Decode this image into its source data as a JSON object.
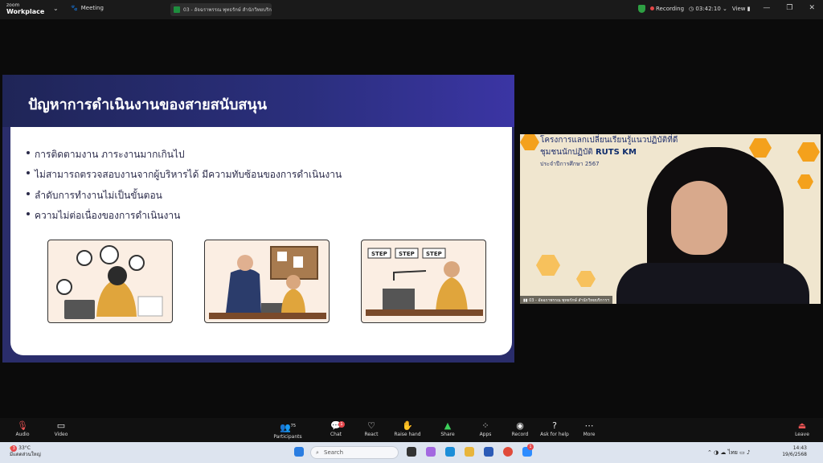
{
  "titlebar": {
    "logo_top": "zoom",
    "logo_bottom": "Workplace",
    "meeting": "Meeting",
    "share_title": "03 - อัจฉราพรรณ พุทธรักษ์ สำนักวิทยบริการ",
    "recording": "Recording",
    "timer": "03:42:10",
    "view": "View"
  },
  "slide": {
    "title": "ปัญหาการดำเนินงานของสายสนับสนุน",
    "bullets": [
      "การติดตามงาน ภาระงานมากเกินไป",
      "ไม่สามารถตรวจสอบงานจากผู้บริหารได้ มีความทับซ้อนของการดำเนินงาน",
      "ลำดับการทำงานไม่เป็นขั้นตอน",
      "ความไม่ต่อเนื่องของการดำเนินงาน"
    ],
    "steps": [
      "STEP",
      "STEP",
      "STEP"
    ]
  },
  "video": {
    "banner_line1": "โครงการแลกเปลี่ยนเรียนรู้แนวปฏิบัติที่ดี",
    "banner_line2": "ชุมชนนักปฏิบัติ",
    "brand": "RUTS KM",
    "year": "ประจำปีการศึกษา 2567",
    "label": "03 - อัจฉราพรรณ พุทธรักษ์ สำนักวิทยบริการฯ"
  },
  "toolbar": {
    "audio": "Audio",
    "video": "Video",
    "participants": "Participants",
    "participants_count": "75",
    "chat": "Chat",
    "chat_badge": "1",
    "react": "React",
    "raise": "Raise hand",
    "share": "Share",
    "apps": "Apps",
    "record": "Record",
    "help": "Ask for help",
    "more": "More",
    "leave": "Leave"
  },
  "taskbar": {
    "temp": "33°C",
    "weather": "มีแดดส่วนใหญ่",
    "weather_badge": "3",
    "search": "Search",
    "lang": "ไทย",
    "time": "14:43",
    "date": "19/6/2568",
    "zoom_badge": "1"
  }
}
